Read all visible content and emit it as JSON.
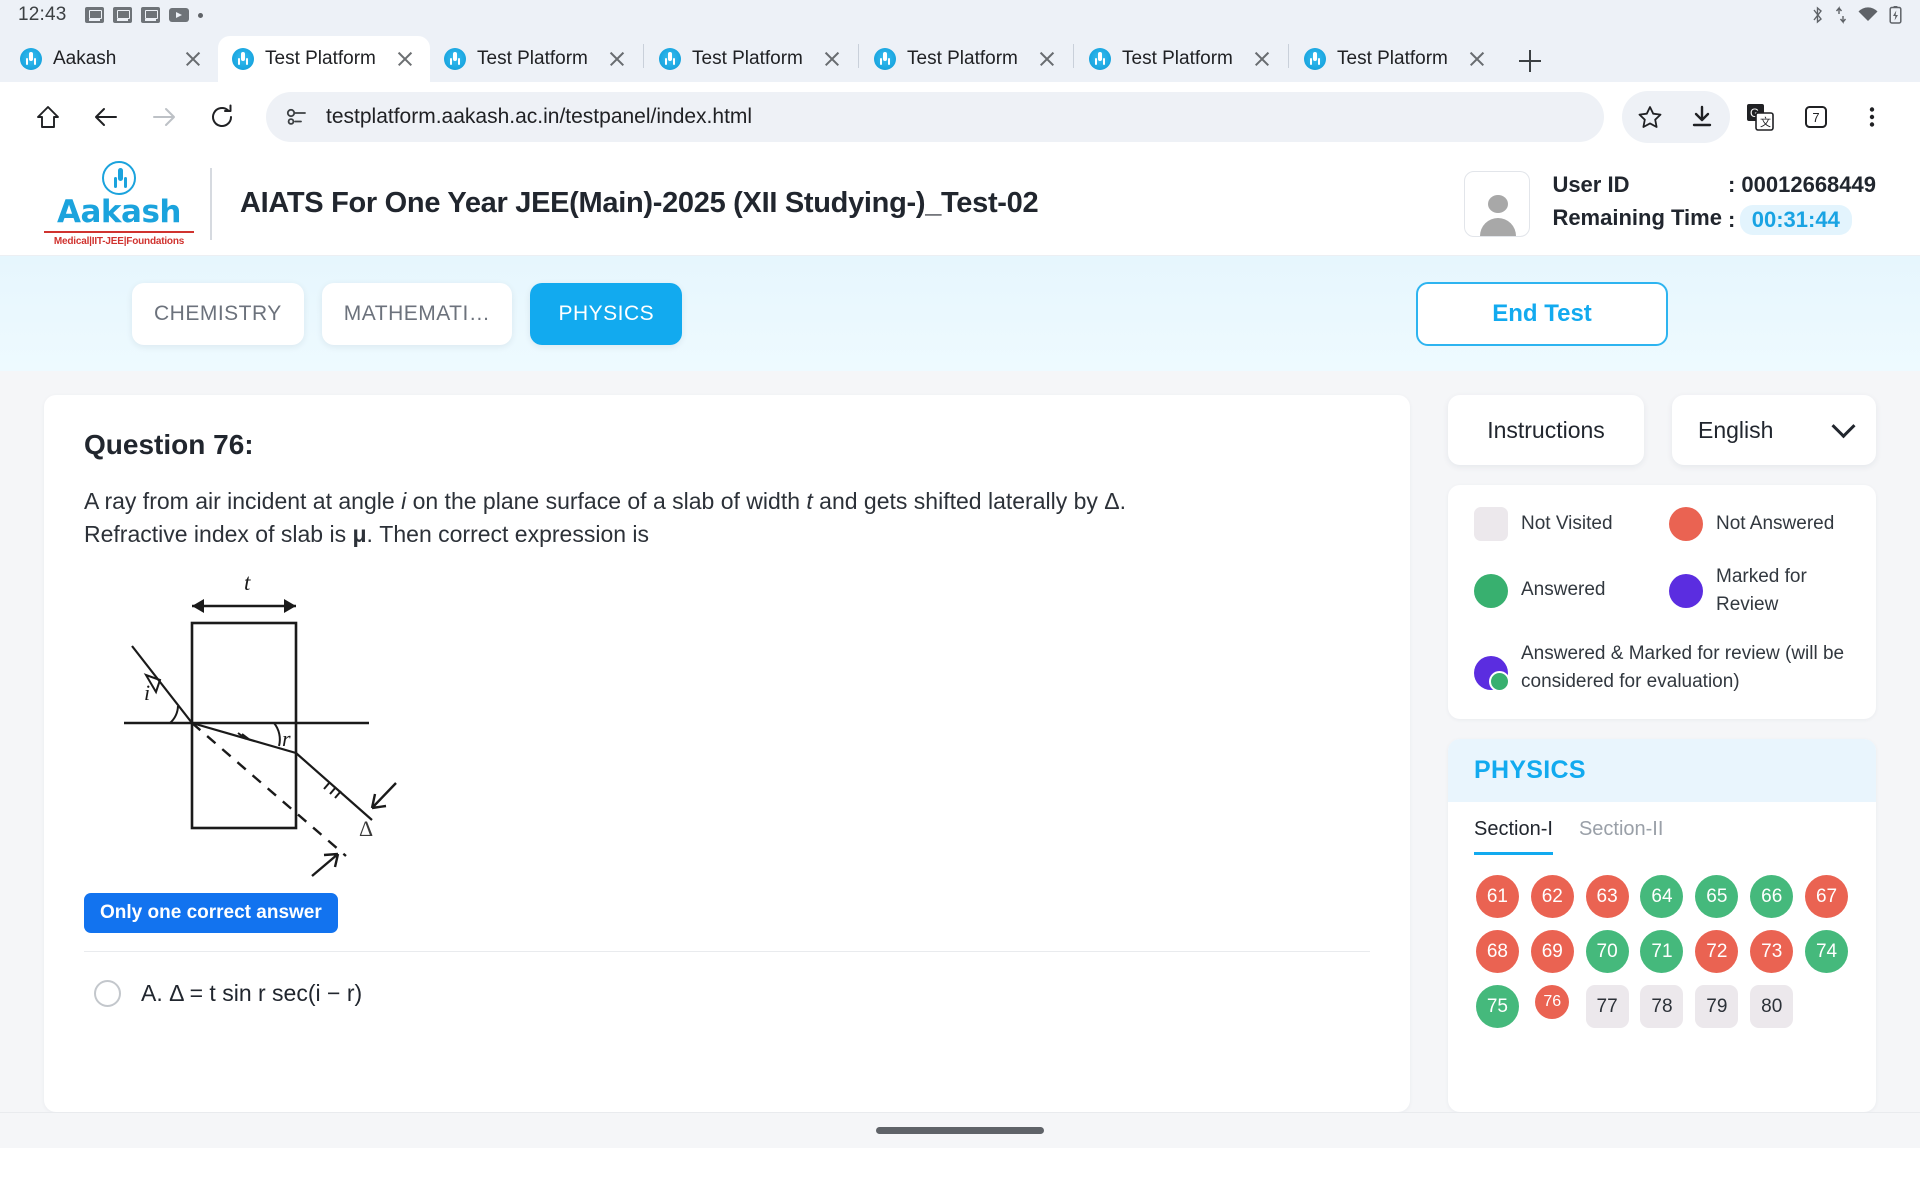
{
  "status_bar": {
    "clock": "12:43",
    "left_icons": [
      "cast-icon",
      "cast-icon",
      "cast-icon",
      "youtube-icon",
      "dot-icon"
    ],
    "right_icons": [
      "bluetooth-icon",
      "data-transfer-icon",
      "wifi-icon",
      "battery-charging-icon"
    ]
  },
  "browser": {
    "tabs": [
      {
        "title": "Aakash",
        "active": false
      },
      {
        "title": "Test Platform",
        "active": true
      },
      {
        "title": "Test Platform",
        "active": false
      },
      {
        "title": "Test Platform",
        "active": false
      },
      {
        "title": "Test Platform",
        "active": false
      },
      {
        "title": "Test Platform",
        "active": false
      },
      {
        "title": "Test Platform",
        "active": false
      }
    ],
    "new_tab_label": "+",
    "url": "testplatform.aakash.ac.in/testpanel/index.html",
    "toolbar_icons": [
      "home-icon",
      "back-icon",
      "forward-icon",
      "reload-icon",
      "site-info-icon",
      "bookmark-star-icon",
      "download-icon",
      "translate-icon",
      "tab-count-icon",
      "kebab-menu-icon"
    ],
    "tab_count": "7"
  },
  "app_header": {
    "logo_word": "Aakash",
    "logo_sub": "Medical|IIT-JEE|Foundations",
    "title": "AIATS For One Year JEE(Main)-2025 (XII Studying-)_Test-02",
    "user_id_label": "User ID",
    "user_id_sep": ": 00012668449",
    "remaining_label": "Remaining Time",
    "remaining_sep": ":",
    "remaining_time": "00:31:44"
  },
  "subject_bar": {
    "tabs": [
      {
        "label": "CHEMISTRY",
        "active": false
      },
      {
        "label": "MATHEMATI…",
        "active": false
      },
      {
        "label": "PHYSICS",
        "active": true
      }
    ],
    "end_test_label": "End Test"
  },
  "question": {
    "title": "Question 76:",
    "text_part1": "A ray from air incident at angle ",
    "text_i": "i",
    "text_part2": " on the plane surface of a slab of width ",
    "text_t": "t",
    "text_part3": " and gets shifted laterally by Δ. Refractive index of slab is ",
    "text_mu": "μ",
    "text_part4": ". Then correct expression is",
    "figure_labels": {
      "thickness": "t",
      "incident_angle": "i",
      "refracted_angle": "r",
      "shift": "Δ"
    },
    "answer_type_badge": "Only one correct answer",
    "options": [
      {
        "key": "A.",
        "formula_plain": "Δ = t sin r sec(i − r)"
      }
    ]
  },
  "sidebar": {
    "instructions_label": "Instructions",
    "language_label": "English",
    "legend": [
      {
        "name": "Not Visited",
        "kind": "square",
        "color": "#ece8ec"
      },
      {
        "name": "Not Answered",
        "kind": "circle",
        "color": "#ea6352"
      },
      {
        "name": "Answered",
        "kind": "circle",
        "color": "#38b06f"
      },
      {
        "name": "Marked for Review",
        "kind": "circle",
        "color": "#5b2de0"
      },
      {
        "name": "Answered & Marked for review (will be considered for evaluation)",
        "kind": "circle-badge",
        "color": "#5b2de0"
      }
    ],
    "palette_title": "PHYSICS",
    "section_tabs": [
      {
        "label": "Section-I",
        "active": true
      },
      {
        "label": "Section-II",
        "active": false
      }
    ],
    "questions": [
      {
        "num": "61",
        "state": "notanswered"
      },
      {
        "num": "62",
        "state": "notanswered"
      },
      {
        "num": "63",
        "state": "notanswered"
      },
      {
        "num": "64",
        "state": "answered"
      },
      {
        "num": "65",
        "state": "answered"
      },
      {
        "num": "66",
        "state": "answered"
      },
      {
        "num": "67",
        "state": "notanswered"
      },
      {
        "num": "68",
        "state": "notanswered"
      },
      {
        "num": "69",
        "state": "notanswered"
      },
      {
        "num": "70",
        "state": "answered"
      },
      {
        "num": "71",
        "state": "answered"
      },
      {
        "num": "72",
        "state": "notanswered"
      },
      {
        "num": "73",
        "state": "notanswered"
      },
      {
        "num": "74",
        "state": "answered"
      },
      {
        "num": "75",
        "state": "answered"
      },
      {
        "num": "76",
        "state": "notanswered",
        "current": true
      },
      {
        "num": "77",
        "state": "notvisited"
      },
      {
        "num": "78",
        "state": "notvisited"
      },
      {
        "num": "79",
        "state": "notvisited"
      },
      {
        "num": "80",
        "state": "notvisited"
      }
    ]
  },
  "colors": {
    "accent_blue": "#12aaef",
    "badge_blue": "#1273ef",
    "answered_green": "#45b97c",
    "not_answered_red": "#ea6352",
    "marked_purple": "#5b2de0",
    "not_visited_grey": "#ece8ec"
  }
}
